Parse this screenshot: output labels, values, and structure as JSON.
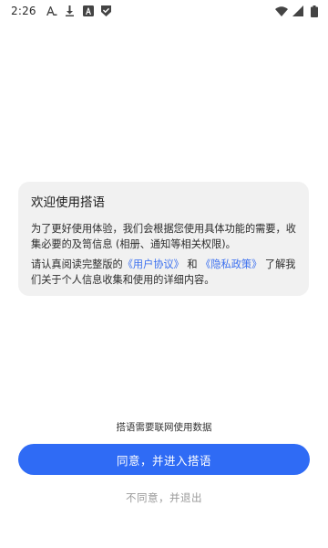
{
  "status_bar": {
    "time": "2:26",
    "left_icons": [
      "font-a-icon",
      "download-icon",
      "app-a-icon",
      "shield-check-icon"
    ],
    "right_icons": [
      "wifi-icon",
      "signal-icon",
      "battery-icon"
    ]
  },
  "consent": {
    "title": "欢迎使用搭语",
    "paragraph1": "为了更好使用体验，我们会根据您使用具体功能的需要，收集必要的及笥信息 (相册、通知等相关权限)。",
    "p2_before": "请认真阅读完整版的",
    "user_agreement_link": "《用户协议》",
    "p2_and": "和",
    "privacy_policy_link": "《隐私政策》",
    "p2_after": "了解我们关于个人信息收集和使用的详细内容。"
  },
  "footer": {
    "network_note": "搭语需要联网使用数据",
    "agree_label": "同意，并进入搭语",
    "disagree_label": "不同意，并退出"
  },
  "colors": {
    "accent": "#2f6bf5",
    "link": "#3a6ff0",
    "card_bg": "#f1f1f1",
    "muted": "#9a9a9a"
  }
}
